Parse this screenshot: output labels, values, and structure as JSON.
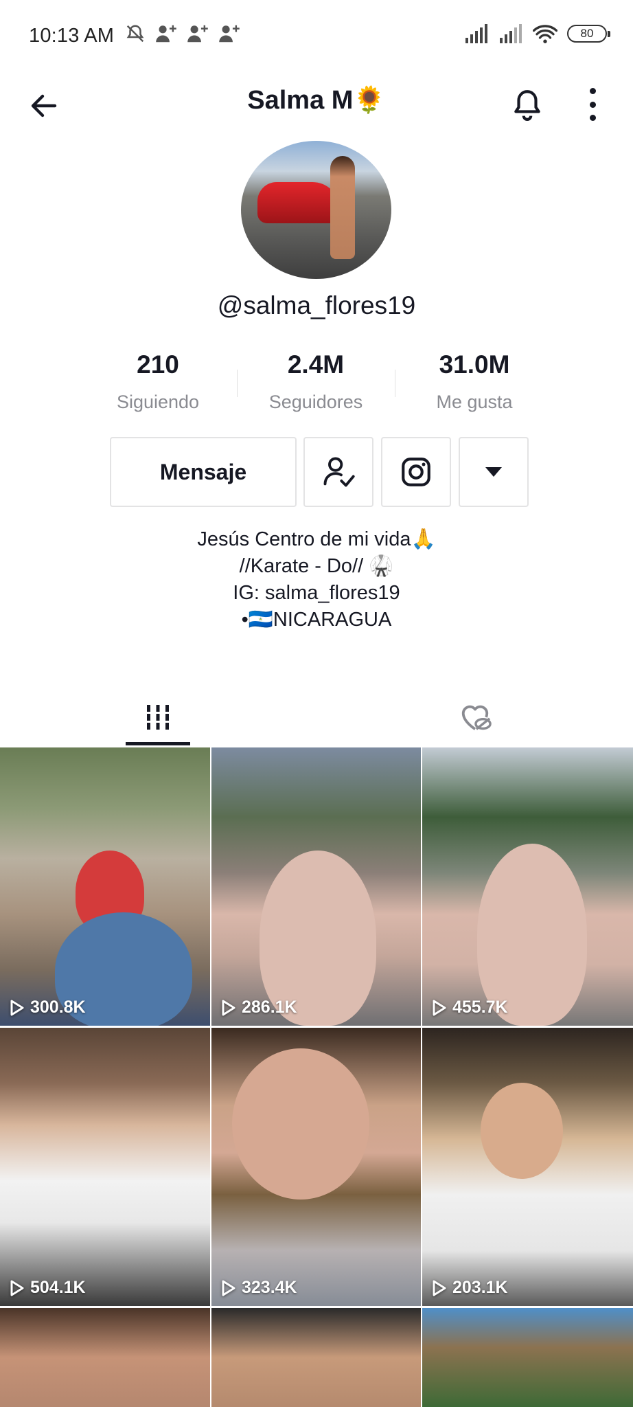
{
  "status_bar": {
    "time": "10:13 AM",
    "battery": "80"
  },
  "header": {
    "title": "Salma M🌻"
  },
  "profile": {
    "username": "@salma_flores19"
  },
  "stats": [
    {
      "value": "210",
      "label": "Siguiendo"
    },
    {
      "value": "2.4M",
      "label": "Seguidores"
    },
    {
      "value": "31.0M",
      "label": "Me gusta"
    }
  ],
  "actions": {
    "message_label": "Mensaje"
  },
  "bio": {
    "lines": [
      "Jesús Centro de mi vida🙏",
      "//Karate - Do// 🥋",
      "IG: salma_flores19",
      "•🇳🇮NICARAGUA"
    ]
  },
  "videos": [
    {
      "views": "300.8K"
    },
    {
      "views": "286.1K"
    },
    {
      "views": "455.7K"
    },
    {
      "views": "504.1K"
    },
    {
      "views": "323.4K"
    },
    {
      "views": "203.1K"
    },
    {
      "views": ""
    },
    {
      "views": ""
    },
    {
      "views": ""
    }
  ]
}
